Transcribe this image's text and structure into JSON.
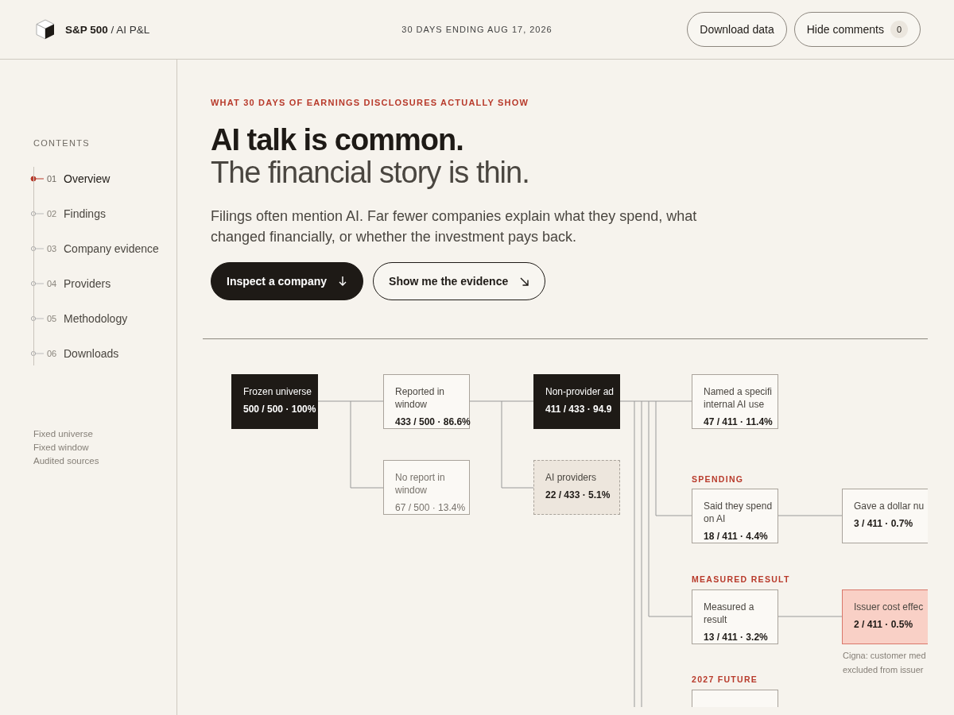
{
  "header": {
    "brand_bold": "S&P 500",
    "brand_rest": "/ AI P&L",
    "period": "30 DAYS ENDING AUG 17, 2026",
    "buttons": [
      {
        "label": "Download data"
      },
      {
        "label": "Hide comments",
        "count": "0"
      }
    ]
  },
  "sidebar": {
    "heading": "CONTENTS",
    "items": [
      {
        "number": "01",
        "label": "Overview",
        "selected": true
      },
      {
        "number": "02",
        "label": "Findings",
        "selected": false
      },
      {
        "number": "03",
        "label": "Company evidence",
        "selected": false
      },
      {
        "number": "04",
        "label": "Providers",
        "selected": false
      },
      {
        "number": "05",
        "label": "Methodology",
        "selected": false
      },
      {
        "number": "06",
        "label": "Downloads",
        "selected": false
      }
    ],
    "notes": [
      "Fixed universe",
      "Fixed window",
      "Audited sources"
    ]
  },
  "hero": {
    "eyebrow": "WHAT 30 DAYS OF EARNINGS DISCLOSURES ACTUALLY SHOW",
    "title": "AI talk is common.",
    "subtitle": "The financial story is thin.",
    "lead": "Filings often mention AI. Far fewer companies explain what they spend, what changed financially, or whether the investment pays back.",
    "actions": [
      {
        "label": "Inspect a company",
        "kind": "primary"
      },
      {
        "label": "Show me the evidence",
        "kind": "secondary"
      }
    ]
  },
  "flow": {
    "sections": [
      "SPENDING",
      "MEASURED RESULT",
      "2027 FUTURE"
    ],
    "nodes": [
      {
        "kind": "dark",
        "label": "Frozen universe",
        "value": "500 / 500 · 100%"
      },
      {
        "kind": "plain",
        "label": "Reported in window",
        "value": "433 / 500 · 86.6%"
      },
      {
        "kind": "dark",
        "label": "Non-provider ad",
        "value": "411 / 433 · 94.9"
      },
      {
        "kind": "plain",
        "label": "Named a specifi internal AI use",
        "value": "47 / 411 · 11.4%"
      },
      {
        "kind": "muted",
        "label": "No report in window",
        "value": "67 / 500 · 13.4%"
      },
      {
        "kind": "provider",
        "label": "AI providers",
        "value": "22 / 433 · 5.1%"
      },
      {
        "kind": "plain",
        "label": "Said they spend on AI",
        "value": "18 / 411 · 4.4%"
      },
      {
        "kind": "plain",
        "label": "Gave a dollar nu",
        "value": "3 / 411 · 0.7%"
      },
      {
        "kind": "plain",
        "label": "Measured a result",
        "value": "13 / 411 · 3.2%"
      },
      {
        "kind": "highlight",
        "label": "Issuer cost effec",
        "value": "2 / 411 · 0.5%"
      },
      {
        "kind": "plain"
      }
    ],
    "note": [
      "Cigna: customer med",
      "excluded from issuer"
    ]
  }
}
